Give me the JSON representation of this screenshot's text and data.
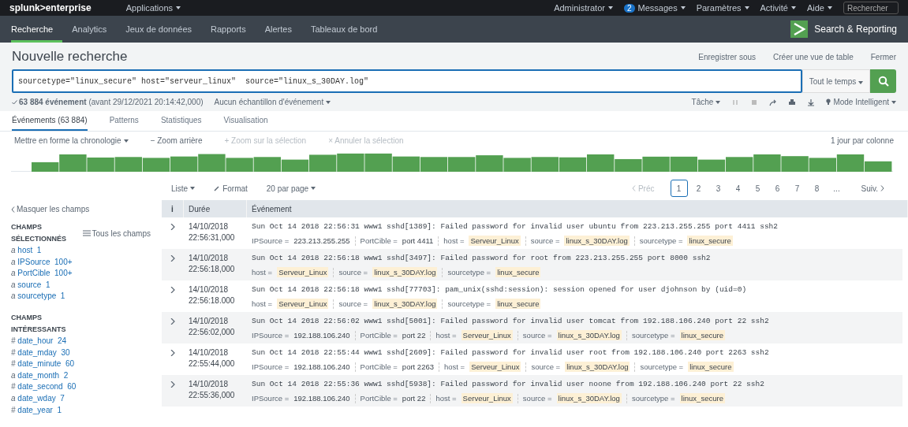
{
  "topbar": {
    "logo": "splunk>enterprise",
    "apps": "Applications",
    "menus": [
      {
        "label": "Administrator"
      },
      {
        "label": "Messages",
        "badge": "2"
      },
      {
        "label": "Paramètres"
      },
      {
        "label": "Activité"
      },
      {
        "label": "Aide"
      }
    ],
    "search_placeholder": "Rechercher"
  },
  "nav": {
    "items": [
      {
        "label": "Recherche",
        "selected": true
      },
      {
        "label": "Analytics",
        "selected": false
      },
      {
        "label": "Jeux de données",
        "selected": false
      },
      {
        "label": "Rapports",
        "selected": false
      },
      {
        "label": "Alertes",
        "selected": false
      },
      {
        "label": "Tableaux de bord",
        "selected": false
      }
    ],
    "app_name": "Search & Reporting"
  },
  "header": {
    "title": "Nouvelle recherche",
    "actions": [
      "Enregistrer sous",
      "Créer une vue de table",
      "Fermer"
    ]
  },
  "search": {
    "value": "sourcetype=\"linux_secure\" host=\"serveur_linux\"  source=\"linux_s_30DAY.log\"",
    "time_range": "Tout le temps"
  },
  "status": {
    "count": "63 884 événement",
    "detail": "(avant 29/12/2021 20:14:42,000)",
    "sampling": "Aucun échantillon d'événement",
    "job": "Tâche",
    "mode": "Mode Intelligent"
  },
  "tabs": [
    {
      "label": "Événements (63 884)",
      "selected": true
    },
    {
      "label": "Patterns",
      "selected": false
    },
    {
      "label": "Statistiques",
      "selected": false
    },
    {
      "label": "Visualisation",
      "selected": false
    }
  ],
  "timeline": {
    "format": "Mettre en forme la chronologie",
    "actions": [
      {
        "label": "− Zoom arrière",
        "disabled": false
      },
      {
        "label": "+ Zoom sur la sélection",
        "disabled": true
      },
      {
        "label": "× Annuler la sélection",
        "disabled": true
      }
    ],
    "scale": "1 jour par colonne"
  },
  "results_toolbar": {
    "view": "Liste",
    "format": "Format",
    "per_page": "20 par page",
    "prev": "Préc",
    "pages": [
      {
        "label": "1",
        "selected": true
      },
      {
        "label": "2",
        "selected": false
      },
      {
        "label": "3",
        "selected": false
      },
      {
        "label": "4",
        "selected": false
      },
      {
        "label": "5",
        "selected": false
      },
      {
        "label": "6",
        "selected": false
      },
      {
        "label": "7",
        "selected": false
      },
      {
        "label": "8",
        "selected": false
      },
      {
        "label": "...",
        "selected": false
      }
    ],
    "next": "Suiv."
  },
  "sidebar": {
    "hide": "Masquer les champs",
    "all_fields": "Tous les champs",
    "groups": [
      {
        "title": "CHAMPS SÉLECTIONNÉS",
        "fields": [
          {
            "type": "a",
            "name": "host",
            "count": "1"
          },
          {
            "type": "a",
            "name": "IPSource",
            "count": "100+"
          },
          {
            "type": "a",
            "name": "PortCible",
            "count": "100+"
          },
          {
            "type": "a",
            "name": "source",
            "count": "1"
          },
          {
            "type": "a",
            "name": "sourcetype",
            "count": "1"
          }
        ]
      },
      {
        "title": "CHAMPS INTÉRESSANTS",
        "fields": [
          {
            "type": "#",
            "name": "date_hour",
            "count": "24"
          },
          {
            "type": "#",
            "name": "date_mday",
            "count": "30"
          },
          {
            "type": "#",
            "name": "date_minute",
            "count": "60"
          },
          {
            "type": "a",
            "name": "date_month",
            "count": "2"
          },
          {
            "type": "#",
            "name": "date_second",
            "count": "60"
          },
          {
            "type": "a",
            "name": "date_wday",
            "count": "7"
          },
          {
            "type": "#",
            "name": "date_year",
            "count": "1"
          }
        ]
      }
    ]
  },
  "table": {
    "columns": [
      "i",
      "Durée",
      "Événement"
    ],
    "rows": [
      {
        "date": "14/10/2018",
        "time": "22:56:31,000",
        "event": "Sun Oct 14 2018 22:56:31 www1 sshd[1389]: Failed password for invalid user ubuntu from 223.213.255.255 port 4411 ssh2",
        "fields": [
          {
            "key": "IPSource =",
            "value": "223.213.255.255",
            "highlighted": false
          },
          {
            "key": "PortCible =",
            "value": "port 4411",
            "highlighted": false
          },
          {
            "key": "host =",
            "value": "Serveur_Linux",
            "highlighted": true
          },
          {
            "key": "source =",
            "value": "linux_s_30DAY.log",
            "highlighted": true
          },
          {
            "key": "sourcetype =",
            "value": "linux_secure",
            "highlighted": true
          }
        ]
      },
      {
        "date": "14/10/2018",
        "time": "22:56:18,000",
        "event": "Sun Oct 14 2018 22:56:18 www1 sshd[3497]: Failed password for root from 223.213.255.255 port 8000 ssh2",
        "fields": [
          {
            "key": "host =",
            "value": "Serveur_Linux",
            "highlighted": true
          },
          {
            "key": "source =",
            "value": "linux_s_30DAY.log",
            "highlighted": true
          },
          {
            "key": "sourcetype =",
            "value": "linux_secure",
            "highlighted": true
          }
        ]
      },
      {
        "date": "14/10/2018",
        "time": "22:56:18.000",
        "event": "Sun Oct 14 2018 22:56:18 www1 sshd[77703]: pam_unix(sshd:session): session opened for user djohnson by (uid=0)",
        "fields": [
          {
            "key": "host =",
            "value": "Serveur_Linux",
            "highlighted": true
          },
          {
            "key": "source =",
            "value": "linux_s_30DAY.log",
            "highlighted": true
          },
          {
            "key": "sourcetype =",
            "value": "linux_secure",
            "highlighted": true
          }
        ]
      },
      {
        "date": "14/10/2018",
        "time": "22:56:02,000",
        "event": "Sun Oct 14 2018 22:56:02 www1 sshd[5001]: Failed password for invalid user tomcat from 192.188.106.240 port 22 ssh2",
        "fields": [
          {
            "key": "IPSource =",
            "value": "192.188.106.240",
            "highlighted": false
          },
          {
            "key": "PortCible =",
            "value": "port 22",
            "highlighted": false
          },
          {
            "key": "host =",
            "value": "Serveur_Linux",
            "highlighted": true
          },
          {
            "key": "source =",
            "value": "linux_s_30DAY.log",
            "highlighted": true
          },
          {
            "key": "sourcetype =",
            "value": "linux_secure",
            "highlighted": true
          }
        ]
      },
      {
        "date": "14/10/2018",
        "time": "22:55:44,000",
        "event": "Sun Oct 14 2018 22:55:44 www1 sshd[2609]: Failed password for invalid user root from 192.188.106.240 port 2263 ssh2",
        "fields": [
          {
            "key": "IPSource =",
            "value": "192.188.106.240",
            "highlighted": false
          },
          {
            "key": "PortCible =",
            "value": "port 2263",
            "highlighted": false
          },
          {
            "key": "host =",
            "value": "Serveur_Linux",
            "highlighted": true
          },
          {
            "key": "source =",
            "value": "linux_s_30DAY.log",
            "highlighted": true
          },
          {
            "key": "sourcetype =",
            "value": "linux_secure",
            "highlighted": true
          }
        ]
      },
      {
        "date": "14/10/2018",
        "time": "22:55:36,000",
        "event": "Sun Oct 14 2018 22:55:36 www1 sshd[5938]: Failed password for invalid user noone from 192.188.106.240 port 22 ssh2",
        "fields": [
          {
            "key": "IPSource =",
            "value": "192.188.106.240",
            "highlighted": false
          },
          {
            "key": "PortCible =",
            "value": "port 22",
            "highlighted": false
          },
          {
            "key": "host =",
            "value": "Serveur_Linux",
            "highlighted": true
          },
          {
            "key": "source =",
            "value": "linux_s_30DAY.log",
            "highlighted": true
          },
          {
            "key": "sourcetype =",
            "value": "linux_secure",
            "highlighted": true
          }
        ]
      }
    ]
  }
}
